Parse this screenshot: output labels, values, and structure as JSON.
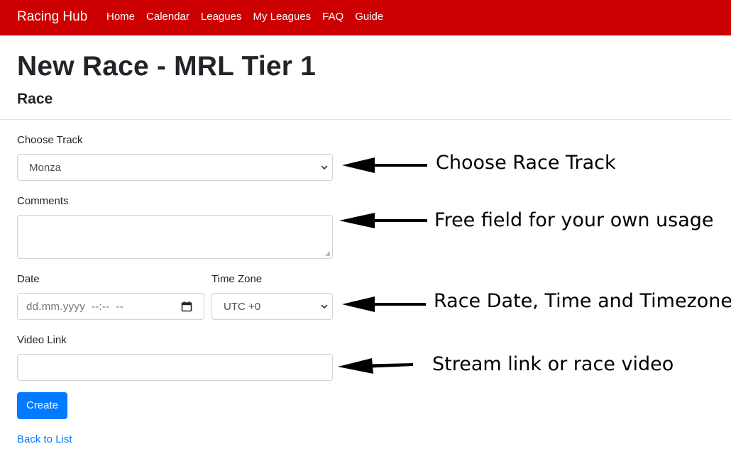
{
  "navbar": {
    "brand": "Racing Hub",
    "links": [
      "Home",
      "Calendar",
      "Leagues",
      "My Leagues",
      "FAQ",
      "Guide"
    ],
    "background_color": "#cc0000"
  },
  "page": {
    "title": "New Race - MRL Tier 1",
    "section": "Race"
  },
  "form": {
    "track": {
      "label": "Choose Track",
      "value": "Monza"
    },
    "comments": {
      "label": "Comments",
      "value": ""
    },
    "date": {
      "label": "Date",
      "placeholder": "dd.mm.yyyy  --:--  --"
    },
    "timezone": {
      "label": "Time Zone",
      "value": "UTC +0"
    },
    "video": {
      "label": "Video Link",
      "value": ""
    },
    "create_button": "Create",
    "back_link": "Back to List"
  },
  "annotations": [
    "Choose Race Track",
    "Free field for your own usage",
    "Race Date, Time and Timezone",
    "Stream link or race video"
  ],
  "colors": {
    "primary": "#007bff",
    "border": "#ced4da"
  },
  "icons": {
    "select_chevron": "chevron-down-icon",
    "calendar": "calendar-icon",
    "arrow": "arrow-left-icon",
    "resize": "resize-grip-icon"
  }
}
